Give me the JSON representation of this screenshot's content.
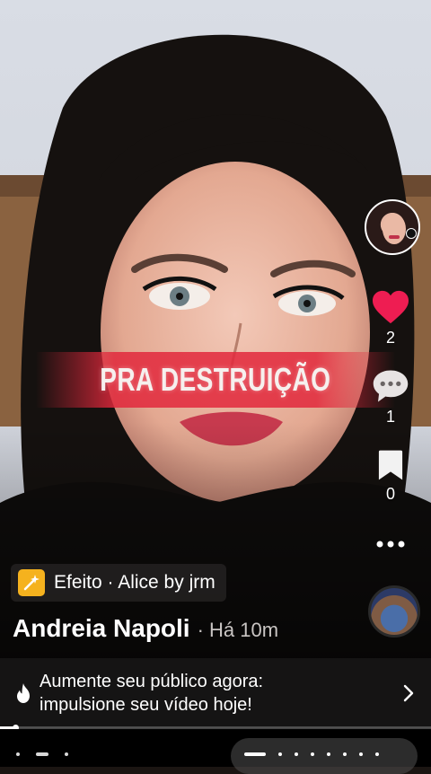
{
  "video": {
    "caption_overlay": "PRA DESTRUIÇÃO"
  },
  "creator": {
    "name": "Andreia Napoli",
    "time_ago": "· Há 10m",
    "avatar_icon": "profile-avatar"
  },
  "actions": {
    "likes": {
      "icon": "heart-icon",
      "count": "2",
      "color": "#ee1d52"
    },
    "comments": {
      "icon": "comment-icon",
      "count": "1"
    },
    "saves": {
      "icon": "bookmark-icon",
      "count": "0"
    },
    "more": {
      "icon": "more-icon"
    }
  },
  "effect": {
    "label": "Efeito · Alice by jrm",
    "icon": "effect-sparkle-icon",
    "accent": "#f5b21e"
  },
  "promo": {
    "icon": "flame-icon",
    "line1": "Aumente seu público agora:",
    "line2": "impulsione seu vídeo hoje!",
    "arrow_icon": "chevron-right-icon"
  },
  "playback": {
    "progress": 0.04
  }
}
